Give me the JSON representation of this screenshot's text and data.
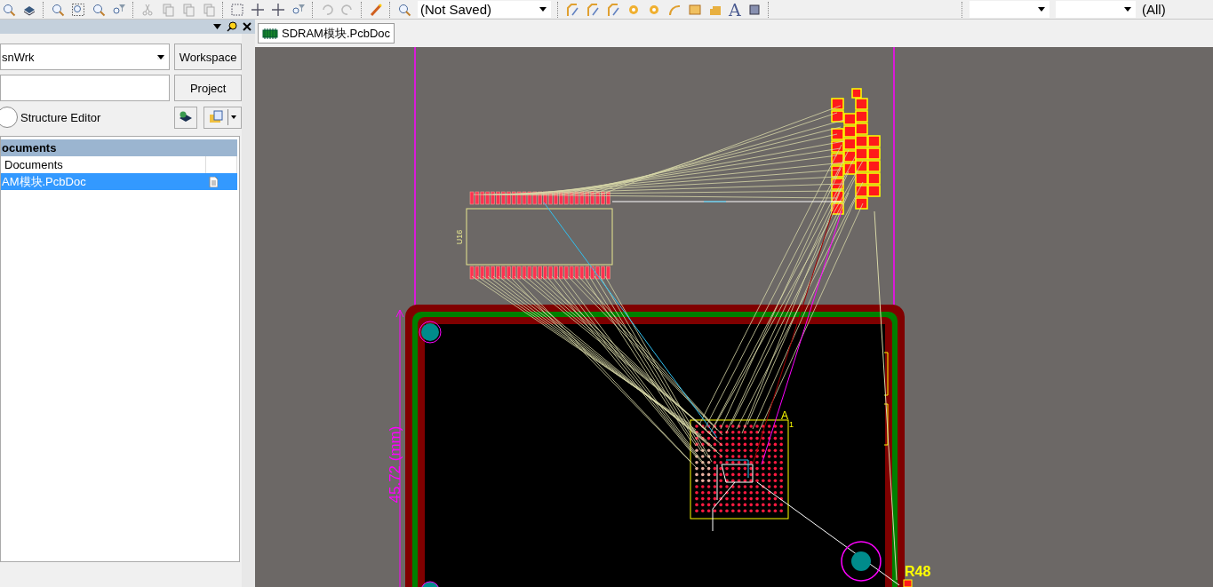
{
  "toolbar": {
    "document_state": {
      "value": "(Not Saved)"
    },
    "text_tool_glyph": "A",
    "layer_filter": {
      "value": "(All)"
    }
  },
  "panel": {
    "workspace_dropdown": {
      "value": "snWrk"
    },
    "workspace_button": "Workspace",
    "project_button": "Project",
    "structure_editor": {
      "label": "Structure Editor",
      "checked": false
    },
    "tree": {
      "header": "ocuments",
      "items": [
        {
          "label": "Documents",
          "selected": false,
          "kind": "folder"
        },
        {
          "label": "AM模块.PcbDoc",
          "selected": true,
          "kind": "file"
        }
      ]
    }
  },
  "document_tab": {
    "label": "SDRAM模块.PcbDoc",
    "selected": true
  },
  "pcb": {
    "designators": [
      {
        "label": "U16"
      },
      {
        "label": "R48"
      }
    ],
    "pin_marks": [
      "A",
      "1"
    ],
    "dimension": "45.72 (mm)"
  }
}
